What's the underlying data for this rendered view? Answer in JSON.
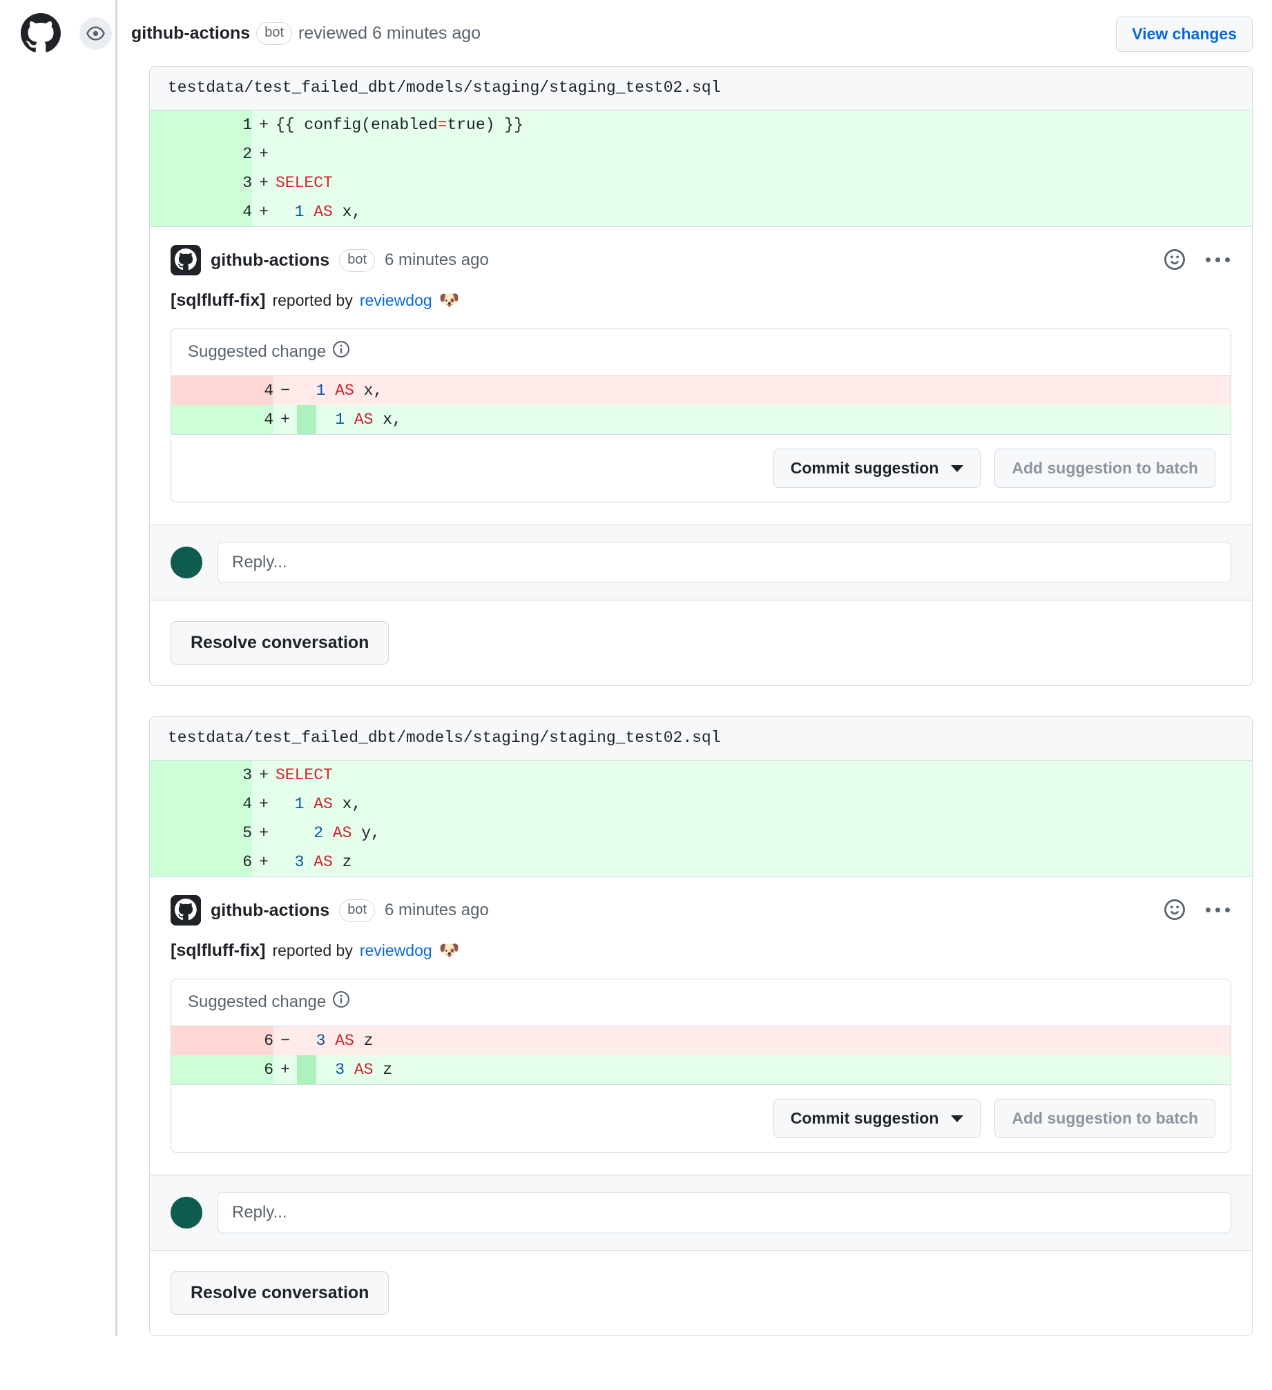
{
  "review": {
    "author": "github-actions",
    "bot_badge": "bot",
    "action_text": "reviewed 6 minutes ago",
    "view_changes_label": "View changes",
    "watch_icon": "eye-icon",
    "avatar_icon": "github-logo-icon"
  },
  "colors": {
    "link": "#0969da",
    "diff_add_bg": "#e6ffec",
    "diff_add_gutter": "#ccffd8",
    "diff_del_bg": "#ffebe9",
    "diff_del_gutter": "#ffd7d5",
    "whitespace_highlight": "#abf2bc",
    "header_bg": "#f6f8fa",
    "border": "#d1d9e0",
    "keyword": "#cf222e",
    "number": "#0550ae",
    "avatar_green": "#0f5c4f"
  },
  "threads": [
    {
      "file_path": "testdata/test_failed_dbt/models/staging/staging_test02.sql",
      "diff_lines": [
        {
          "line_no": "1",
          "sign": "+",
          "type": "add",
          "tokens": [
            {
              "t": "{{ config(",
              "c": "plain"
            },
            {
              "t": "enabled",
              "c": "plain"
            },
            {
              "t": "=",
              "c": "op"
            },
            {
              "t": "true) }}",
              "c": "plain"
            }
          ]
        },
        {
          "line_no": "2",
          "sign": "+",
          "type": "add",
          "tokens": []
        },
        {
          "line_no": "3",
          "sign": "+",
          "type": "add",
          "tokens": [
            {
              "t": "SELECT",
              "c": "kw"
            }
          ]
        },
        {
          "line_no": "4",
          "sign": "+",
          "type": "add",
          "tokens": [
            {
              "t": "  ",
              "c": "plain"
            },
            {
              "t": "1",
              "c": "num"
            },
            {
              "t": " ",
              "c": "plain"
            },
            {
              "t": "AS",
              "c": "kw"
            },
            {
              "t": " x,",
              "c": "plain"
            }
          ]
        }
      ],
      "comment": {
        "author": "github-actions",
        "bot_badge": "bot",
        "timestamp": "6 minutes ago",
        "tool": "[sqlfluff-fix]",
        "reported_by": "reported by",
        "reporter_link": "reviewdog",
        "reporter_emoji": "🐶",
        "reaction_icon": "smiley-icon",
        "more_icon": "kebab-menu-icon"
      },
      "suggestion": {
        "title": "Suggested change",
        "info_icon": "info-icon",
        "lines": [
          {
            "line_no": "4",
            "sign": "−",
            "type": "del",
            "tokens": [
              {
                "t": "  ",
                "c": "plain"
              },
              {
                "t": "1",
                "c": "num"
              },
              {
                "t": " ",
                "c": "plain"
              },
              {
                "t": "AS",
                "c": "kw"
              },
              {
                "t": " x,",
                "c": "plain"
              }
            ]
          },
          {
            "line_no": "4",
            "sign": "+",
            "type": "add",
            "tokens": [
              {
                "t": "  ",
                "c": "ws"
              },
              {
                "t": "  ",
                "c": "plain"
              },
              {
                "t": "1",
                "c": "num"
              },
              {
                "t": " ",
                "c": "plain"
              },
              {
                "t": "AS",
                "c": "kw"
              },
              {
                "t": " x,",
                "c": "plain"
              }
            ]
          }
        ],
        "commit_label": "Commit suggestion",
        "batch_label": "Add suggestion to batch",
        "caret_icon": "chevron-down-icon"
      },
      "reply_placeholder": "Reply...",
      "resolve_label": "Resolve conversation"
    },
    {
      "file_path": "testdata/test_failed_dbt/models/staging/staging_test02.sql",
      "diff_lines": [
        {
          "line_no": "3",
          "sign": "+",
          "type": "add",
          "tokens": [
            {
              "t": "SELECT",
              "c": "kw"
            }
          ]
        },
        {
          "line_no": "4",
          "sign": "+",
          "type": "add",
          "tokens": [
            {
              "t": "  ",
              "c": "plain"
            },
            {
              "t": "1",
              "c": "num"
            },
            {
              "t": " ",
              "c": "plain"
            },
            {
              "t": "AS",
              "c": "kw"
            },
            {
              "t": " x,",
              "c": "plain"
            }
          ]
        },
        {
          "line_no": "5",
          "sign": "+",
          "type": "add",
          "tokens": [
            {
              "t": "    ",
              "c": "plain"
            },
            {
              "t": "2",
              "c": "num"
            },
            {
              "t": " ",
              "c": "plain"
            },
            {
              "t": "AS",
              "c": "kw"
            },
            {
              "t": " y,",
              "c": "plain"
            }
          ]
        },
        {
          "line_no": "6",
          "sign": "+",
          "type": "add",
          "tokens": [
            {
              "t": "  ",
              "c": "plain"
            },
            {
              "t": "3",
              "c": "num"
            },
            {
              "t": " ",
              "c": "plain"
            },
            {
              "t": "AS",
              "c": "kw"
            },
            {
              "t": " z",
              "c": "plain"
            }
          ]
        }
      ],
      "comment": {
        "author": "github-actions",
        "bot_badge": "bot",
        "timestamp": "6 minutes ago",
        "tool": "[sqlfluff-fix]",
        "reported_by": "reported by",
        "reporter_link": "reviewdog",
        "reporter_emoji": "🐶",
        "reaction_icon": "smiley-icon",
        "more_icon": "kebab-menu-icon"
      },
      "suggestion": {
        "title": "Suggested change",
        "info_icon": "info-icon",
        "lines": [
          {
            "line_no": "6",
            "sign": "−",
            "type": "del",
            "tokens": [
              {
                "t": "  ",
                "c": "plain"
              },
              {
                "t": "3",
                "c": "num"
              },
              {
                "t": " ",
                "c": "plain"
              },
              {
                "t": "AS",
                "c": "kw"
              },
              {
                "t": " z",
                "c": "plain"
              }
            ]
          },
          {
            "line_no": "6",
            "sign": "+",
            "type": "add",
            "tokens": [
              {
                "t": "  ",
                "c": "ws"
              },
              {
                "t": "  ",
                "c": "plain"
              },
              {
                "t": "3",
                "c": "num"
              },
              {
                "t": " ",
                "c": "plain"
              },
              {
                "t": "AS",
                "c": "kw"
              },
              {
                "t": " z",
                "c": "plain"
              }
            ]
          }
        ],
        "commit_label": "Commit suggestion",
        "batch_label": "Add suggestion to batch",
        "caret_icon": "chevron-down-icon"
      },
      "reply_placeholder": "Reply...",
      "resolve_label": "Resolve conversation"
    }
  ]
}
